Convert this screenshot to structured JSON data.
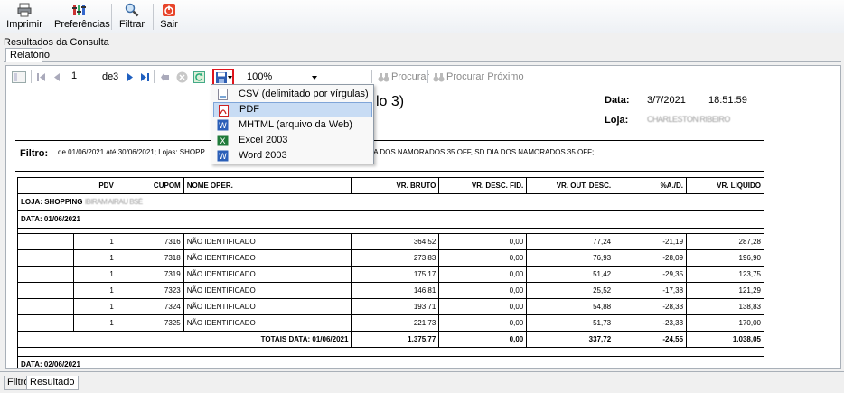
{
  "toolbar": {
    "imprimir": "Imprimir",
    "preferencias": "Preferências",
    "filtrar": "Filtrar",
    "sair": "Sair"
  },
  "caption": "Resultados da Consulta",
  "tab_relatorio": "Relatório",
  "report_toolbar": {
    "page_current": "1",
    "page_of": "de",
    "page_total": "3",
    "zoom": "100%",
    "procurar": "Procurar",
    "procurar_proximo": "Procurar Próximo"
  },
  "export_menu": [
    {
      "label": "CSV (delimitado por vírgulas)",
      "icon": "csv-icon"
    },
    {
      "label": "PDF",
      "icon": "pdf-icon",
      "selected": true
    },
    {
      "label": "MHTML (arquivo da Web)",
      "icon": "word-icon"
    },
    {
      "label": "Excel 2003",
      "icon": "excel-icon"
    },
    {
      "label": "Word 2003",
      "icon": "word-icon"
    }
  ],
  "report": {
    "title_fragment": "lo 3)",
    "data_label": "Data:",
    "data_value": "3/7/2021",
    "hora_value": "18:51:59",
    "loja_label": "Loja:",
    "loja_value": "CHARLESTON RIBEIRO",
    "filtro_label": "Filtro:",
    "filtro_value_a": "de 01/06/2021 até 30/06/2021; Lojas: SHOPP",
    "filtro_value_b": "IA DOS NAMORADOS 35 OFF, SD DIA DOS NAMORADOS 35 OFF;",
    "columns": [
      "PDV",
      "CUPOM",
      "NOME OPER.",
      "VR. BRUTO",
      "VR. DESC. FID.",
      "VR. OUT. DESC.",
      "%A./D.",
      "VR. LIQUIDO"
    ],
    "loja_row": "LOJA: SHOPPING",
    "loja_row_blurred": "IBIRAM AIRAU BSÉ",
    "data_row": "DATA: 01/06/2021",
    "rows": [
      {
        "pdv": "1",
        "cupom": "7316",
        "nome": "NÃO IDENTIFICADO",
        "bruto": "364,52",
        "fid": "0,00",
        "out": "77,24",
        "ad": "-21,19",
        "liq": "287,28"
      },
      {
        "pdv": "1",
        "cupom": "7318",
        "nome": "NÃO IDENTIFICADO",
        "bruto": "273,83",
        "fid": "0,00",
        "out": "76,93",
        "ad": "-28,09",
        "liq": "196,90"
      },
      {
        "pdv": "1",
        "cupom": "7319",
        "nome": "NÃO IDENTIFICADO",
        "bruto": "175,17",
        "fid": "0,00",
        "out": "51,42",
        "ad": "-29,35",
        "liq": "123,75"
      },
      {
        "pdv": "1",
        "cupom": "7323",
        "nome": "NÃO IDENTIFICADO",
        "bruto": "146,81",
        "fid": "0,00",
        "out": "25,52",
        "ad": "-17,38",
        "liq": "121,29"
      },
      {
        "pdv": "1",
        "cupom": "7324",
        "nome": "NÃO IDENTIFICADO",
        "bruto": "193,71",
        "fid": "0,00",
        "out": "54,88",
        "ad": "-28,33",
        "liq": "138,83"
      },
      {
        "pdv": "1",
        "cupom": "7325",
        "nome": "NÃO IDENTIFICADO",
        "bruto": "221,73",
        "fid": "0,00",
        "out": "51,73",
        "ad": "-23,33",
        "liq": "170,00"
      }
    ],
    "totals": {
      "label": "TOTAIS DATA: 01/06/2021",
      "bruto": "1.375,77",
      "fid": "0,00",
      "out": "337,72",
      "ad": "-24,55",
      "liq": "1.038,05"
    },
    "next_data_row": "DATA: 02/06/2021"
  },
  "bottom_tabs": {
    "filtro": "Filtro",
    "resultado": "Resultado"
  },
  "colors": {
    "accent_red": "#e0141c",
    "menu_selected": "#c8dcf4",
    "toolbar_blue": "#1f5fbf"
  }
}
